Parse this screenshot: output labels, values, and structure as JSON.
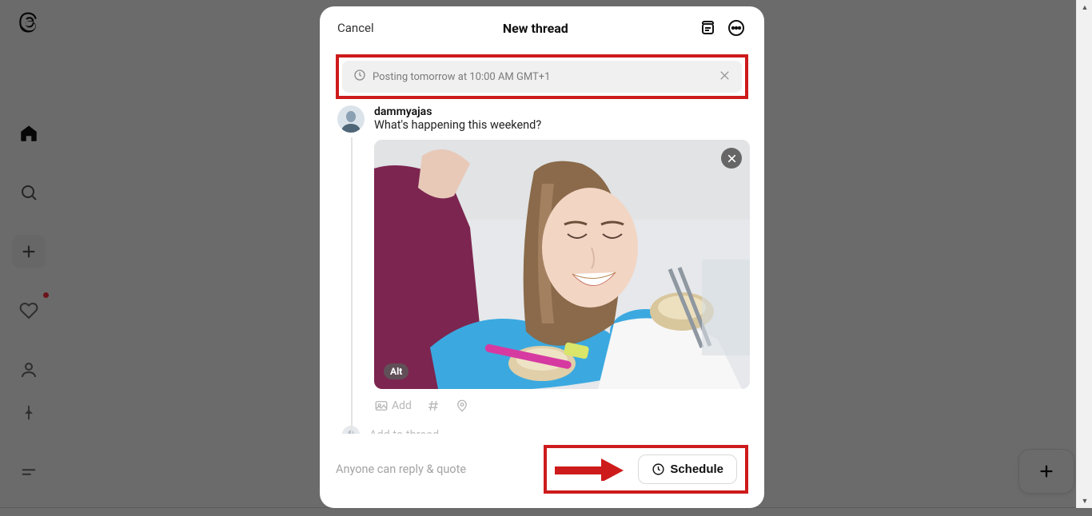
{
  "modal": {
    "cancel": "Cancel",
    "title": "New thread",
    "banner_text": "Posting tomorrow at 10:00 AM GMT+1"
  },
  "post": {
    "username": "dammyajas",
    "text": "What's happening this weekend?",
    "alt_label": "Alt",
    "add_label": "Add",
    "add_to_thread": "Add to thread"
  },
  "footer": {
    "reply_scope": "Anyone can reply & quote",
    "schedule_label": "Schedule"
  }
}
